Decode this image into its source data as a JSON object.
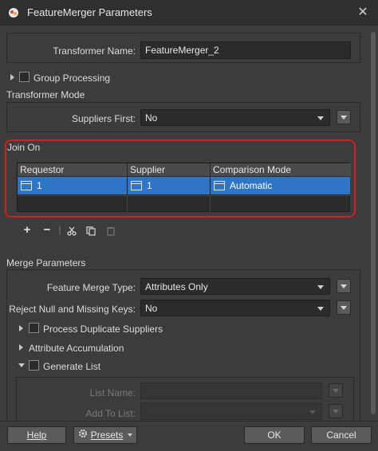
{
  "window": {
    "title": "FeatureMerger Parameters"
  },
  "transformer_name": {
    "label": "Transformer Name:",
    "value": "FeatureMerger_2"
  },
  "group_processing": {
    "label": "Group Processing"
  },
  "transformer_mode": {
    "title": "Transformer Mode",
    "suppliers_first_label": "Suppliers First:",
    "suppliers_first_value": "No"
  },
  "join_on": {
    "title": "Join On",
    "columns": [
      "Requestor",
      "Supplier",
      "Comparison Mode"
    ],
    "rows": [
      {
        "requestor": "1",
        "supplier": "1",
        "comparison_mode": "Automatic"
      }
    ]
  },
  "toolbar": {
    "add": "+",
    "remove": "−",
    "sep": "|"
  },
  "merge_parameters": {
    "title": "Merge Parameters",
    "feature_merge_type_label": "Feature Merge Type:",
    "feature_merge_type_value": "Attributes Only",
    "reject_null_label": "Reject Null and Missing Keys:",
    "reject_null_value": "No",
    "process_duplicate_label": "Process Duplicate Suppliers",
    "attribute_accumulation_label": "Attribute Accumulation",
    "generate_list_label": "Generate List",
    "list_name_label": "List Name:",
    "add_to_list_label": "Add To List:"
  },
  "footer": {
    "help": "Help",
    "presets": "Presets",
    "ok": "OK",
    "cancel": "Cancel"
  },
  "colors": {
    "selection": "#2e75c8",
    "highlight": "#d42020"
  }
}
